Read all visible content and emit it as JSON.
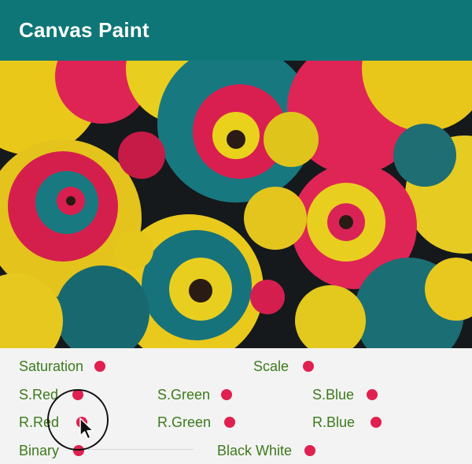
{
  "appbar": {
    "title": "Canvas Paint",
    "background": "#0e7676"
  },
  "image": {
    "icon": "rose-photo"
  },
  "controls": {
    "saturation": "Saturation",
    "scale": "Scale",
    "s_red": "S.Red",
    "s_green": "S.Green",
    "s_blue": "S.Blue",
    "r_red": "R.Red",
    "r_green": "R.Green",
    "r_blue": "R.Blue",
    "binary": "Binary",
    "black_white": "Black White"
  },
  "colors": {
    "label": "#3c7a1c",
    "thumb": "#e0204f",
    "background": "#f3f3f3"
  },
  "cursor": {
    "icon": "mouse-pointer-icon"
  }
}
